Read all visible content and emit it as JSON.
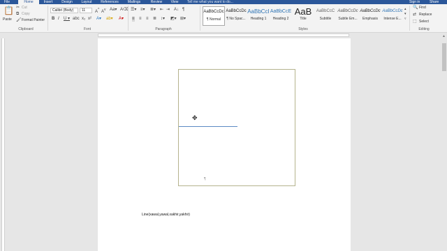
{
  "tabs": [
    "File",
    "Home",
    "Insert",
    "Design",
    "Layout",
    "References",
    "Mailings",
    "Review",
    "View"
  ],
  "tell_me": "Tell me what you want to do...",
  "sign_in": "Sign in",
  "share": "Share",
  "clipboard": {
    "paste": "Paste",
    "cut": "Cut",
    "copy": "Copy",
    "format_painter": "Format Painter",
    "label": "Clipboard"
  },
  "font": {
    "family": "Calibri (Body)",
    "size": "11",
    "label": "Font"
  },
  "paragraph": {
    "label": "Paragraph"
  },
  "styles": {
    "label": "Styles",
    "items": [
      {
        "sample": "AaBbCcDc",
        "name": "¶ Normal"
      },
      {
        "sample": "AaBbCcDc",
        "name": "¶ No Spac..."
      },
      {
        "sample": "AaBbCcI",
        "name": "Heading 1"
      },
      {
        "sample": "AaBbCcE",
        "name": "Heading 2"
      },
      {
        "sample": "AaB",
        "name": "Title"
      },
      {
        "sample": "AaBbCcC",
        "name": "Subtitle"
      },
      {
        "sample": "AaBbCcDc",
        "name": "Subtle Em..."
      },
      {
        "sample": "AaBbCcDc",
        "name": "Emphasis"
      },
      {
        "sample": "AaBbCcDc",
        "name": "Intense E..."
      }
    ]
  },
  "editing": {
    "find": "Find",
    "replace": "Replace",
    "select": "Select",
    "label": "Editing"
  },
  "document": {
    "code_text": "Line(xawal,yawal,xakhir,yakhir)",
    "para_mark": "¶"
  },
  "colors": {
    "accent": "#2b579a",
    "line": "#5b8ac4",
    "canvas_border": "#b5b38d"
  }
}
